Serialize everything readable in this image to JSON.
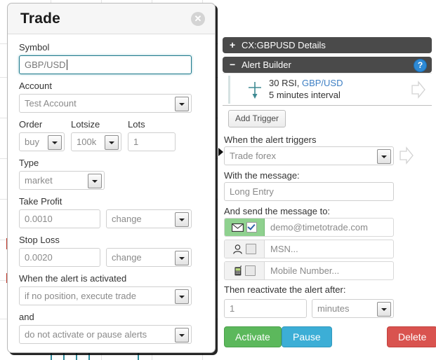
{
  "modal": {
    "title": "Trade",
    "close_icon": "close-x-icon",
    "fields": {
      "symbol": {
        "label": "Symbol",
        "value": "GBP/USD",
        "focused": true
      },
      "account": {
        "label": "Account",
        "value": "Test Account"
      },
      "order": {
        "label": "Order",
        "value": "buy"
      },
      "lotsize": {
        "label": "Lotsize",
        "value": "100k"
      },
      "lots": {
        "label": "Lots",
        "value": "1"
      },
      "type": {
        "label": "Type",
        "value": "market"
      },
      "take_profit": {
        "label": "Take Profit",
        "value": "0.0010",
        "mode": "change"
      },
      "stop_loss": {
        "label": "Stop Loss",
        "value": "0.0020",
        "mode": "change"
      },
      "when_activated": {
        "label": "When the alert is activated",
        "value": "if no position, execute trade"
      },
      "and": {
        "label": "and",
        "value": "do not activate or pause alerts"
      }
    }
  },
  "right_panel": {
    "details_bar": {
      "sign": "+",
      "label": "CX:GBPUSD Details"
    },
    "alert_builder_bar": {
      "sign": "−",
      "label": "Alert Builder",
      "help_icon": "help-question-icon",
      "help_label": "?"
    },
    "trigger": {
      "icon": "cross-down-arrow-icon",
      "line1_prefix": "30 RSI, ",
      "line1_symbol": "GBP/USD",
      "line2": "5 minutes interval",
      "ghost_icon": "ghost-right-arrow-icon"
    },
    "add_trigger_label": "Add Trigger",
    "when_triggers": {
      "label": "When the alert triggers",
      "value": "Trade forex",
      "ghost_icon": "ghost-right-arrow-icon"
    },
    "with_message": {
      "label": "With the message:",
      "value": "Long Entry"
    },
    "send_to": {
      "label": "And send the message to:",
      "rows": [
        {
          "icon": "envelope-icon",
          "checked": true,
          "value": "demo@timetotrade.com"
        },
        {
          "icon": "person-icon",
          "checked": false,
          "value": "MSN..."
        },
        {
          "icon": "mobile-phone-icon",
          "checked": false,
          "value": "Mobile Number..."
        }
      ]
    },
    "reactivate": {
      "label": "Then reactivate the alert after:",
      "value": "1",
      "unit": "minutes"
    },
    "buttons": {
      "activate": {
        "label": "Activate",
        "color": "#5cb85c"
      },
      "pause": {
        "label": "Pause",
        "color": "#3caed6"
      },
      "delete": {
        "label": "Delete",
        "color": "#d9534f"
      }
    }
  }
}
